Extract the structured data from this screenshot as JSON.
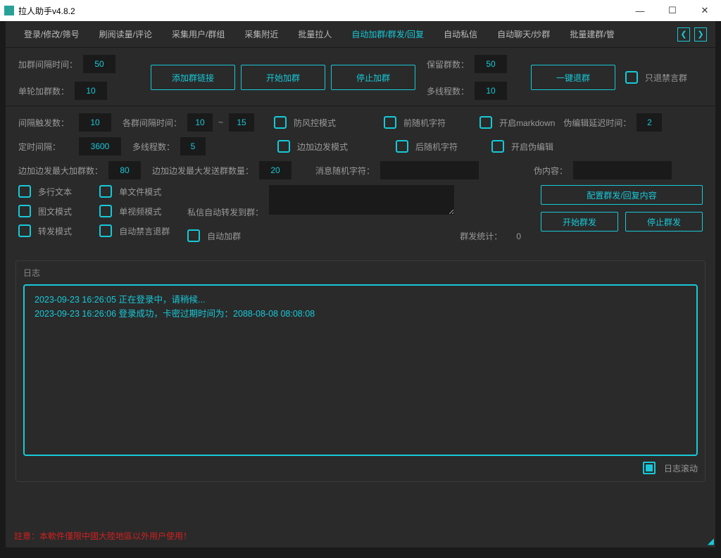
{
  "window": {
    "title": "拉人助手v4.8.2"
  },
  "tabs": [
    "登录/修改/筛号",
    "刷阅读量/评论",
    "采集用户/群组",
    "采集附近",
    "批量拉人",
    "自动加群/群发/回复",
    "自动私信",
    "自动聊天/炒群",
    "批量建群/管"
  ],
  "group1": {
    "interval_label": "加群间隔时间：",
    "interval": "50",
    "per_round_label": "单轮加群数：",
    "per_round": "10",
    "btn_add_link": "添加群链接",
    "btn_start": "开始加群",
    "btn_stop": "停止加群",
    "keep_label": "保留群数：",
    "keep": "50",
    "threads_label": "多线程数：",
    "threads": "10",
    "btn_exit_all": "一键退群",
    "only_exit_muted": "只退禁言群"
  },
  "group2": {
    "trigger_label": "间隔触发数：",
    "trigger": "10",
    "per_group_label": "各群间隔时间：",
    "per_group_a": "10",
    "tilde": "~",
    "per_group_b": "15",
    "timed_label": "定时间隔：",
    "timed": "3600",
    "threads_label": "多线程数：",
    "threads": "5",
    "chk_anti": "防风控模式",
    "chk_simul": "边加边发模式",
    "chk_pre": "前随机字符",
    "chk_post": "后随机字符",
    "chk_md": "开启markdown",
    "chk_fake": "开启伪编辑",
    "fake_delay_label": "伪编辑延迟时间：",
    "fake_delay": "2",
    "max_join_label": "边加边发最大加群数：",
    "max_join": "80",
    "max_send_label": "边加边发最大发送群数量：",
    "max_send": "20",
    "msg_rand_label": "消息随机字符：",
    "fake_content_label": "伪内容："
  },
  "group3": {
    "multi_text": "多行文本",
    "single_file": "单文件模式",
    "image_text": "图文模式",
    "single_video": "单视频模式",
    "forward": "转发模式",
    "auto_mute_exit": "自动禁言退群",
    "auto_join": "自动加群",
    "dm_forward_label": "私信自动转发到群：",
    "stats_label": "群发统计：",
    "stats_value": "0",
    "btn_config": "配置群发/回复内容",
    "btn_start_send": "开始群发",
    "btn_stop_send": "停止群发"
  },
  "log": {
    "title": "日志",
    "lines": [
      "2023-09-23 16:26:05 正在登录中，请稍候...",
      "2023-09-23 16:26:06 登录成功，卡密过期时间为：2088-08-08 08:08:08"
    ],
    "scroll": "日志滚动"
  },
  "footer": {
    "warn": "註意：本軟件僅限中國大陸地區以外用户使用！"
  }
}
